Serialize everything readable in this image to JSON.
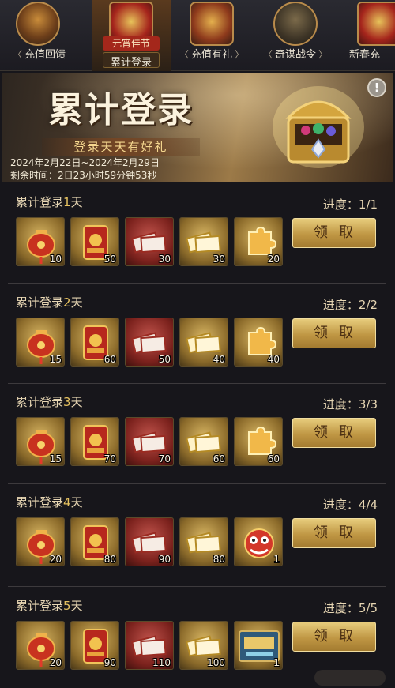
{
  "tabs": [
    {
      "label": "充值回馈",
      "icon": "tower-icon"
    },
    {
      "label": "累计登录",
      "top_label": "元宵佳节",
      "icon": "gift-box-icon",
      "active": true
    },
    {
      "label": "充值有礼",
      "icon": "treasure-chest-icon"
    },
    {
      "label": "奇谋战令",
      "icon": "dragon-emblem-icon"
    },
    {
      "label": "新春充",
      "icon": "gift-icon"
    }
  ],
  "banner": {
    "title": "累计登录",
    "subtitle": "登录天天有好礼",
    "dates": "2024年2月22日~2024年2月29日",
    "remaining": "剩余时间：2日23小时59分钟53秒",
    "info_icon": "!"
  },
  "rows": [
    {
      "title_prefix": "累计登录",
      "day": "1",
      "title_suffix": "天",
      "progress": "进度：1/1",
      "button": "领取",
      "items": [
        {
          "icon": "red-lantern-icon",
          "count": "10",
          "quality": "gold"
        },
        {
          "icon": "red-envelope-icon",
          "count": "50",
          "quality": "gold"
        },
        {
          "icon": "red-tickets-icon",
          "count": "30",
          "quality": "red"
        },
        {
          "icon": "gold-tickets-icon",
          "count": "30",
          "quality": "gold"
        },
        {
          "icon": "gold-puzzle-icon",
          "count": "20",
          "quality": "gold"
        }
      ]
    },
    {
      "title_prefix": "累计登录",
      "day": "2",
      "title_suffix": "天",
      "progress": "进度：2/2",
      "button": "领取",
      "items": [
        {
          "icon": "red-lantern-icon",
          "count": "15",
          "quality": "gold"
        },
        {
          "icon": "red-envelope-icon",
          "count": "60",
          "quality": "gold"
        },
        {
          "icon": "red-tickets-icon",
          "count": "50",
          "quality": "red"
        },
        {
          "icon": "gold-tickets-icon",
          "count": "40",
          "quality": "gold"
        },
        {
          "icon": "gold-puzzle-icon",
          "count": "40",
          "quality": "gold"
        }
      ]
    },
    {
      "title_prefix": "累计登录",
      "day": "3",
      "title_suffix": "天",
      "progress": "进度：3/3",
      "button": "领取",
      "items": [
        {
          "icon": "red-lantern-icon",
          "count": "15",
          "quality": "gold"
        },
        {
          "icon": "red-envelope-icon",
          "count": "70",
          "quality": "gold"
        },
        {
          "icon": "red-tickets-icon",
          "count": "70",
          "quality": "red"
        },
        {
          "icon": "gold-tickets-icon",
          "count": "60",
          "quality": "gold"
        },
        {
          "icon": "gold-puzzle-icon",
          "count": "60",
          "quality": "gold"
        }
      ]
    },
    {
      "title_prefix": "累计登录",
      "day": "4",
      "title_suffix": "天",
      "progress": "进度：4/4",
      "button": "领取",
      "items": [
        {
          "icon": "red-lantern-icon",
          "count": "20",
          "quality": "gold"
        },
        {
          "icon": "red-envelope-icon",
          "count": "80",
          "quality": "gold"
        },
        {
          "icon": "red-tickets-icon",
          "count": "90",
          "quality": "red"
        },
        {
          "icon": "gold-tickets-icon",
          "count": "80",
          "quality": "gold"
        },
        {
          "icon": "lion-dance-icon",
          "count": "1",
          "quality": "gold"
        }
      ]
    },
    {
      "title_prefix": "累计登录",
      "day": "5",
      "title_suffix": "天",
      "progress": "进度：5/5",
      "button": "领取",
      "items": [
        {
          "icon": "red-lantern-icon",
          "count": "20",
          "quality": "gold"
        },
        {
          "icon": "red-envelope-icon",
          "count": "90",
          "quality": "gold"
        },
        {
          "icon": "red-tickets-icon",
          "count": "110",
          "quality": "red"
        },
        {
          "icon": "gold-tickets-icon",
          "count": "100",
          "quality": "gold"
        },
        {
          "icon": "scroll-card-icon",
          "count": "1",
          "quality": "gold"
        }
      ]
    }
  ]
}
